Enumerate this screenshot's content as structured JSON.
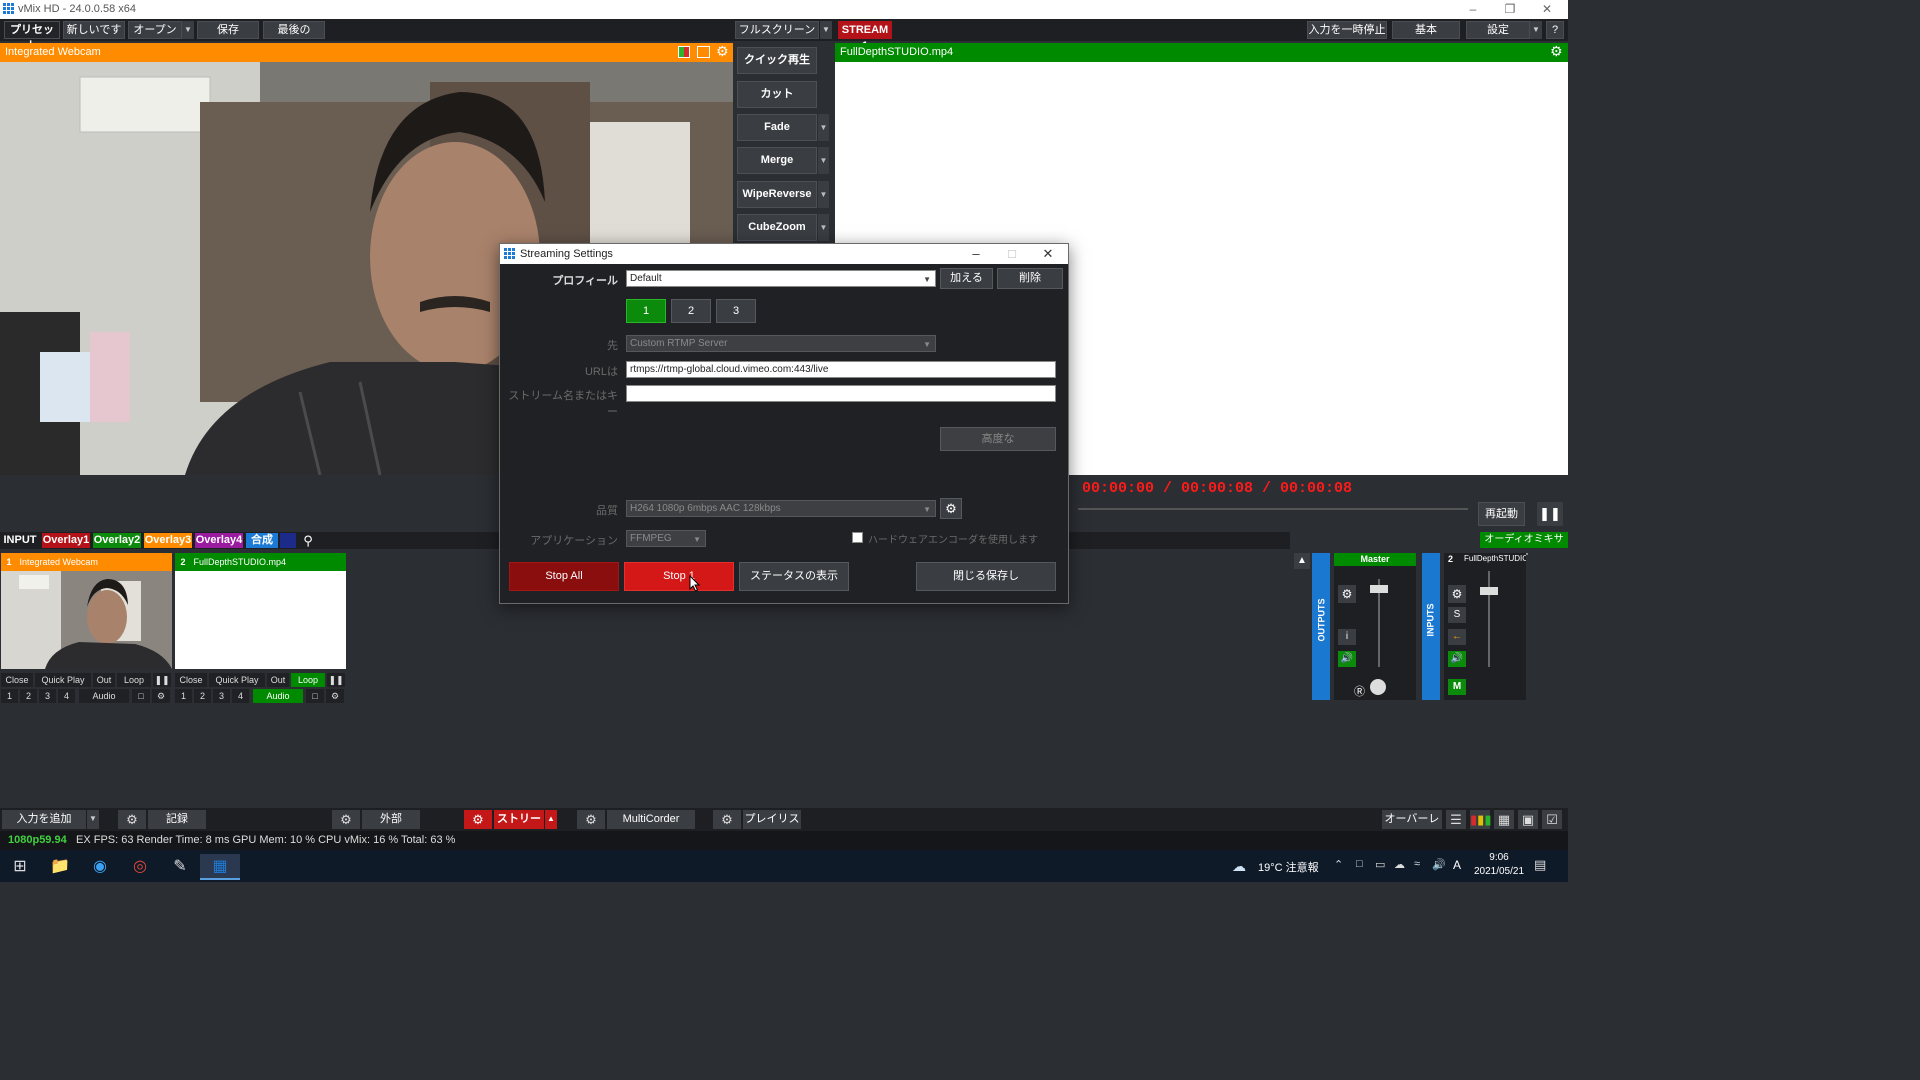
{
  "window": {
    "title": "vMix HD - 24.0.0.58 x64"
  },
  "menubar": {
    "preset": "プリセット",
    "new": "新しいです",
    "open": "オープン",
    "save": "保存",
    "last": "最後の",
    "fullscreen": "フルスクリーン",
    "stream_badge": "STREAM 1",
    "pause_inputs": "入力を一時停止",
    "basic": "基本",
    "settings": "設定",
    "help": "?"
  },
  "preview": {
    "title": "Integrated Webcam"
  },
  "output": {
    "title": "FullDepthSTUDIO.mp4"
  },
  "transitions": [
    "クイック再生",
    "カット",
    "Fade",
    "Merge",
    "WipeReverse",
    "CubeZoom"
  ],
  "timeline": {
    "timecode": "00:00:00 / 00:00:08 / 00:00:08",
    "restart": "再起動"
  },
  "input_tabs": [
    {
      "label": "INPUT",
      "color": "#1d1f22"
    },
    {
      "label": "Overlay1",
      "color": "#b31218"
    },
    {
      "label": "Overlay2",
      "color": "#0c8a0c"
    },
    {
      "label": "Overlay3",
      "color": "#ff8c00"
    },
    {
      "label": "Overlay4",
      "color": "#9a1aa0"
    },
    {
      "label": "合成",
      "color": "#1a7ad6"
    }
  ],
  "inputs": [
    {
      "num": "1",
      "title": "Integrated Webcam",
      "color": "#ff8c00",
      "buttons": [
        "Close",
        "Quick Play",
        "Out",
        "Loop"
      ],
      "sub": [
        "1",
        "2",
        "3",
        "4"
      ],
      "audio": "Audio"
    },
    {
      "num": "2",
      "title": "FullDepthSTUDIO.mp4",
      "color": "#008a00",
      "buttons": [
        "Close",
        "Quick Play",
        "Out",
        "Loop"
      ],
      "sub": [
        "1",
        "2",
        "3",
        "4"
      ],
      "audio": "Audio"
    }
  ],
  "audio": {
    "mixer": "オーディオミキサー",
    "master": "Master",
    "outputs": "OUTPUTS",
    "inputs": "INPUTS",
    "input2_num": "2",
    "input2_name": "FullDepthSTUDIO",
    "btn_i": "i",
    "btn_s": "S",
    "btn_m": "M"
  },
  "bottombar": {
    "add_input": "入力を追加",
    "record": "記録",
    "external": "外部",
    "stream": "ストリーム",
    "multicorder": "MultiCorder",
    "playlist": "プレイリスト",
    "overlay": "オーバーレイ"
  },
  "status": {
    "format": "1080p59.94",
    "stats": "EX FPS:  63  Render Time:  8 ms  GPU Mem:  10 %  CPU vMix:  16 %  Total:  63 %"
  },
  "taskbar": {
    "weather": "19°C 注意報",
    "time": "9:06",
    "date": "2021/05/21",
    "ime": "A"
  },
  "dialog": {
    "title": "Streaming Settings",
    "profile_label": "プロフィール",
    "profile_value": "Default",
    "add": "加える",
    "delete": "削除",
    "tabs": [
      "1",
      "2",
      "3"
    ],
    "dest_label": "先",
    "dest_value": "Custom RTMP Server",
    "url_label": "URLは",
    "url_value": "rtmps://rtmp-global.cloud.vimeo.com:443/live",
    "key_label": "ストリーム名またはキー",
    "key_value": "",
    "advanced": "高度な",
    "quality_label": "品質",
    "quality_value": "H264 1080p 6mbps AAC 128kbps",
    "app_label": "アプリケーション",
    "app_value": "FFMPEG",
    "hw_encoder": "ハードウェアエンコーダを使用します",
    "stop_all": "Stop All",
    "stop": "Stop 1",
    "show_status": "ステータスの表示",
    "close_save": "閉じる保存し"
  }
}
